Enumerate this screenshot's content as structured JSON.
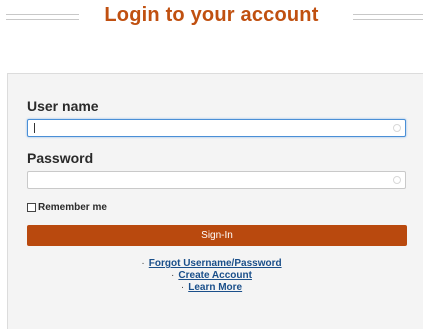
{
  "header": {
    "title": "Login to your account"
  },
  "form": {
    "username_label": "User name",
    "username_value": "",
    "password_label": "Password",
    "password_value": "",
    "remember_label": "Remember me",
    "signin_label": "Sign-In"
  },
  "links": [
    {
      "label": "Forgot Username/Password"
    },
    {
      "label": "Create Account"
    },
    {
      "label": "Learn More"
    }
  ],
  "colors": {
    "title": "#c05010",
    "button": "#b9490e",
    "link": "#1a4f8a",
    "panel": "#f4f4f4"
  }
}
